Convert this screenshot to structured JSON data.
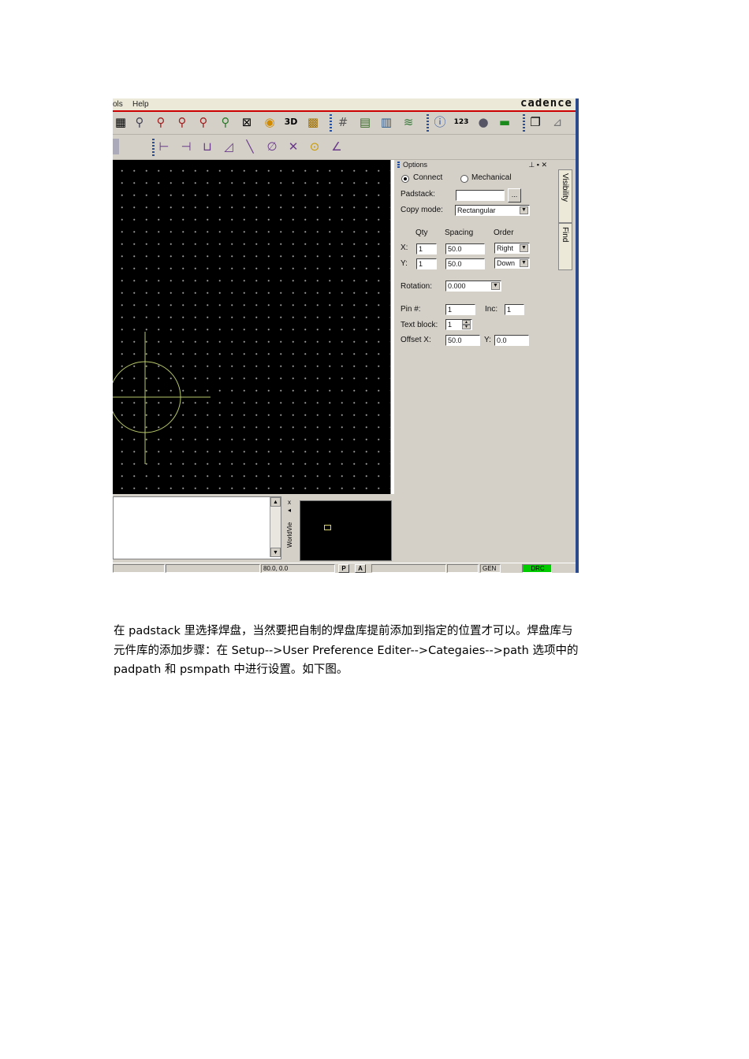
{
  "menu": {
    "tools": "ols",
    "help": "Help",
    "brand": "cadence"
  },
  "toolbar1_icons": [
    "grid-view-icon",
    "zoom-in-icon",
    "zoom-point-icon",
    "zoom-fit-icon",
    "zoom-out-icon",
    "zoom-previous-icon",
    "zoom-world-icon",
    "redraw-icon",
    "3d-view-icon",
    "flip-icon",
    "grid-icon",
    "color-icon",
    "layer-icon",
    "stack-icon",
    "info-icon",
    "count-icon",
    "status-icon",
    "rats-icon",
    "copy-icon",
    "report-icon"
  ],
  "toolbar2_icons": [
    "dimension-icon",
    "measure-icon",
    "angle-icon",
    "line-icon",
    "arc-icon",
    "cross-icon",
    "curve-icon",
    "circle-icon",
    "axis-icon"
  ],
  "options": {
    "title": "Options",
    "title_controls": "⊥ ▪ ✕",
    "connect": "Connect",
    "mechanical": "Mechanical",
    "padstack_label": "Padstack:",
    "padstack_value": "",
    "browse": "...",
    "copy_mode_label": "Copy mode:",
    "copy_mode_value": "Rectangular",
    "qty_label": "Qty",
    "spacing_label": "Spacing",
    "order_label": "Order",
    "x_label": "X:",
    "y_label": "Y:",
    "x_qty": "1",
    "x_spacing": "50.0",
    "x_order": "Right",
    "y_qty": "1",
    "y_spacing": "50.0",
    "y_order": "Down",
    "rotation_label": "Rotation:",
    "rotation_value": "0.000",
    "pin_label": "Pin #:",
    "pin_value": "1",
    "inc_label": "Inc:",
    "inc_value": "1",
    "textblock_label": "Text block:",
    "textblock_value": "1",
    "offsetx_label": "Offset X:",
    "offsetx_value": "50.0",
    "offsety_label": "Y:",
    "offsety_value": "0.0"
  },
  "tabs": {
    "visibility": "Visibility",
    "find": "Find"
  },
  "worldview": {
    "close": "x",
    "pin": "◂",
    "label": "WorldVie"
  },
  "status": {
    "coords": "80.0, 0.0",
    "p": "P",
    "a": "A",
    "gen": "GEN",
    "drc": "DRC",
    "drc_color": "#00cc00"
  },
  "paragraph": {
    "line1": "在 padstack 里选择焊盘，当然要把自制的焊盘库提前添加到指定的位置才可以。焊盘库与",
    "line2": "元件库的添加步骤：在 Setup-->User Preference Editer-->Categaies-->path 选项中的",
    "line3": "padpath 和 psmpath 中进行设置。如下图。"
  }
}
